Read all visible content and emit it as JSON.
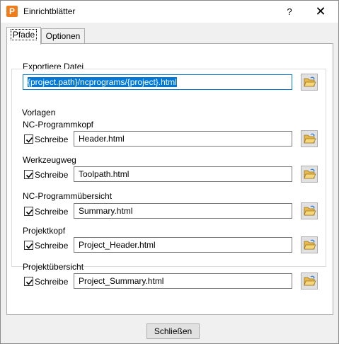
{
  "window": {
    "title": "Einrichtblätter",
    "help": "?",
    "close": "✕",
    "app_icon": "P"
  },
  "tabs": [
    {
      "label": "Pfade",
      "active": true
    },
    {
      "label": "Optionen",
      "active": false
    }
  ],
  "export": {
    "label": "Exportiere Datei",
    "value": "{project.path}/ncprograms/{project}.html"
  },
  "templates": {
    "title": "Vorlagen",
    "checkbox_label": "Schreibe",
    "items": [
      {
        "heading": "NC-Programmkopf",
        "file": "Header.html",
        "checked": true
      },
      {
        "heading": "Werkzeugweg",
        "file": "Toolpath.html",
        "checked": true
      },
      {
        "heading": "NC-Programmübersicht",
        "file": "Summary.html",
        "checked": true
      },
      {
        "heading": "Projektkopf",
        "file": "Project_Header.html",
        "checked": true
      },
      {
        "heading": "Projektübersicht",
        "file": "Project_Summary.html",
        "checked": true
      }
    ]
  },
  "buttons": {
    "close_label": "Schließen"
  },
  "icons": {
    "browse": "folder-open-icon",
    "check": "checkmark-icon"
  }
}
